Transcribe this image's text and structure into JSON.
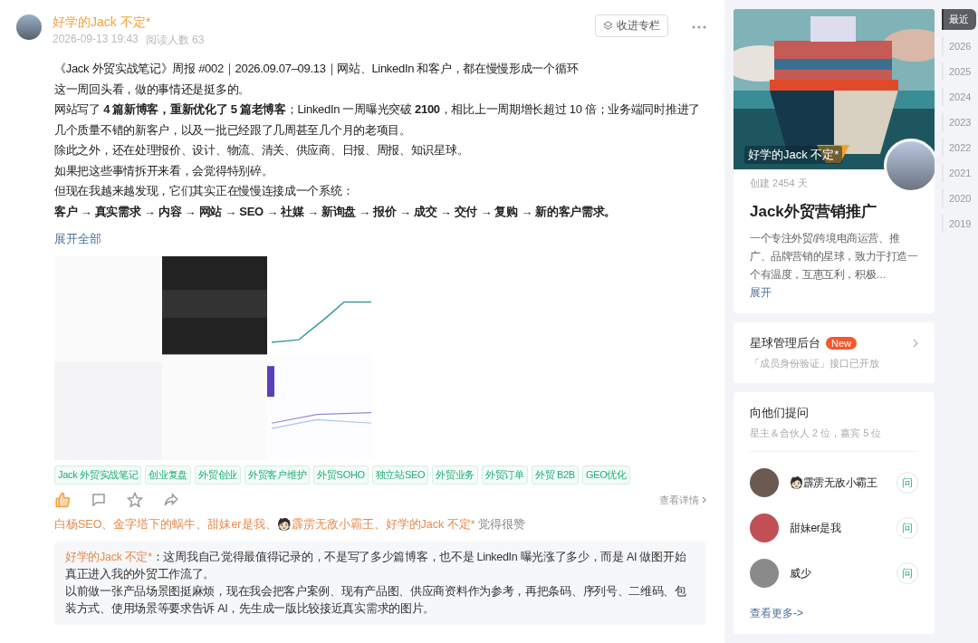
{
  "post": {
    "author": "好学的Jack 不定*",
    "date": "2026-09-13 19:43",
    "reads": "阅读人数 63",
    "collect_button": "收进专栏",
    "title_line": "《Jack 外贸实战笔记》周报 #002｜2026.09.07–09.13｜网站、LinkedIn 和客户，都在慢慢形成一个循环",
    "paragraphs": [
      "这一周回头看，做的事情还是挺多的。",
      "网站写了 **4 篇新博客，重新优化了 5 篇老博客**；LinkedIn 一周曝光突破 **2100**，相比上一周期增长超过 10 倍；业务端同时推进了几个质量不错的新客户，以及一批已经跟了几周甚至几个月的老项目。",
      "除此之外，还在处理报价、设计、物流、清关、供应商、日报、周报、知识星球。",
      "如果把这些事情拆开来看，会觉得特别碎。",
      "但现在我越来越发现，它们其实正在慢慢连接成一个系统：",
      "**客户 → 真实需求 → 内容 → 网站 → SEO → 社媒 → 新询盘 → 报价 → 成交 → 交付 → 复购 → 新的客户需求。**"
    ],
    "expand_link": "展开全部",
    "tags": [
      "Jack 外贸实战笔记",
      "创业复盘",
      "外贸创业",
      "外贸客户维护",
      "外贸SOHO",
      "独立站SEO",
      "外贸业务",
      "外贸订单",
      "外贸 B2B",
      "GEO优化"
    ],
    "liked": true,
    "details_link": "查看详情",
    "likers": [
      "白杨SEO",
      "金字塔下的蜗牛",
      "甜妹er是我",
      "🧑🏻霹雳无敌小霸王",
      "好学的Jack 不定*"
    ],
    "likers_suffix": "觉得很赞",
    "liker_separator": "、",
    "comment": {
      "author": "好学的Jack 不定*",
      "paragraphs": [
        "：这周我自己觉得最值得记录的，不是写了多少篇博客，也不是 LinkedIn 曝光涨了多少，而是 AI 做图开始真正进入我的外贸工作流了。",
        "以前做一张产品场景图挺麻烦，现在我会把客户案例、现有产品图、供应商资料作为参考，再把条码、序列号、二维码、包装方式、使用场景等要求告诉 AI，先生成一版比较接近真实需求的图片。"
      ]
    }
  },
  "group": {
    "owner": "好学的Jack 不定*",
    "created": "创建 2454 天",
    "name": "Jack外贸营销推广",
    "description": "一个专注外贸/跨境电商运营、推广、品牌营销的星球，致力于打造一个有温度，互惠互利，积极…",
    "expand": "展开"
  },
  "admin": {
    "title": "星球管理后台",
    "badge": "New",
    "subtitle": "「成员身份验证」接口已开放"
  },
  "ask": {
    "title": "向他们提问",
    "subtitle": "星主＆合伙人 2 位，嘉宾 5 位",
    "people": [
      {
        "name": "🧑🏻霹雳无敌小霸王",
        "button": "问"
      },
      {
        "name": "甜妹er是我",
        "button": "问"
      },
      {
        "name": "威少",
        "button": "问"
      }
    ],
    "more": "查看更多->"
  },
  "years": [
    {
      "label": "最近",
      "selected": true
    },
    {
      "label": "2026",
      "selected": false
    },
    {
      "label": "2025",
      "selected": false
    },
    {
      "label": "2024",
      "selected": false
    },
    {
      "label": "2023",
      "selected": false
    },
    {
      "label": "2022",
      "selected": false
    },
    {
      "label": "2021",
      "selected": false
    },
    {
      "label": "2020",
      "selected": false
    },
    {
      "label": "2019",
      "selected": false
    }
  ]
}
